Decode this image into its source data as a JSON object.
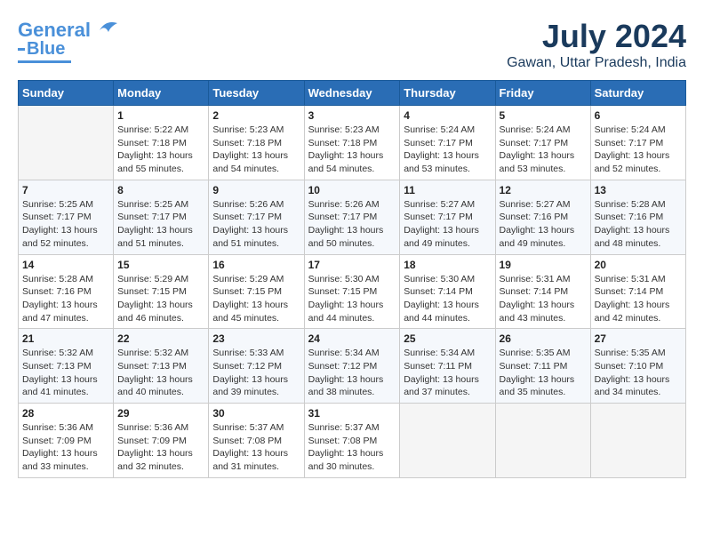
{
  "header": {
    "logo_line1": "General",
    "logo_line2": "Blue",
    "month_year": "July 2024",
    "location": "Gawan, Uttar Pradesh, India"
  },
  "calendar": {
    "days_of_week": [
      "Sunday",
      "Monday",
      "Tuesday",
      "Wednesday",
      "Thursday",
      "Friday",
      "Saturday"
    ],
    "weeks": [
      [
        {
          "day": "",
          "info": ""
        },
        {
          "day": "1",
          "info": "Sunrise: 5:22 AM\nSunset: 7:18 PM\nDaylight: 13 hours\nand 55 minutes."
        },
        {
          "day": "2",
          "info": "Sunrise: 5:23 AM\nSunset: 7:18 PM\nDaylight: 13 hours\nand 54 minutes."
        },
        {
          "day": "3",
          "info": "Sunrise: 5:23 AM\nSunset: 7:18 PM\nDaylight: 13 hours\nand 54 minutes."
        },
        {
          "day": "4",
          "info": "Sunrise: 5:24 AM\nSunset: 7:17 PM\nDaylight: 13 hours\nand 53 minutes."
        },
        {
          "day": "5",
          "info": "Sunrise: 5:24 AM\nSunset: 7:17 PM\nDaylight: 13 hours\nand 53 minutes."
        },
        {
          "day": "6",
          "info": "Sunrise: 5:24 AM\nSunset: 7:17 PM\nDaylight: 13 hours\nand 52 minutes."
        }
      ],
      [
        {
          "day": "7",
          "info": "Sunrise: 5:25 AM\nSunset: 7:17 PM\nDaylight: 13 hours\nand 52 minutes."
        },
        {
          "day": "8",
          "info": "Sunrise: 5:25 AM\nSunset: 7:17 PM\nDaylight: 13 hours\nand 51 minutes."
        },
        {
          "day": "9",
          "info": "Sunrise: 5:26 AM\nSunset: 7:17 PM\nDaylight: 13 hours\nand 51 minutes."
        },
        {
          "day": "10",
          "info": "Sunrise: 5:26 AM\nSunset: 7:17 PM\nDaylight: 13 hours\nand 50 minutes."
        },
        {
          "day": "11",
          "info": "Sunrise: 5:27 AM\nSunset: 7:17 PM\nDaylight: 13 hours\nand 49 minutes."
        },
        {
          "day": "12",
          "info": "Sunrise: 5:27 AM\nSunset: 7:16 PM\nDaylight: 13 hours\nand 49 minutes."
        },
        {
          "day": "13",
          "info": "Sunrise: 5:28 AM\nSunset: 7:16 PM\nDaylight: 13 hours\nand 48 minutes."
        }
      ],
      [
        {
          "day": "14",
          "info": "Sunrise: 5:28 AM\nSunset: 7:16 PM\nDaylight: 13 hours\nand 47 minutes."
        },
        {
          "day": "15",
          "info": "Sunrise: 5:29 AM\nSunset: 7:15 PM\nDaylight: 13 hours\nand 46 minutes."
        },
        {
          "day": "16",
          "info": "Sunrise: 5:29 AM\nSunset: 7:15 PM\nDaylight: 13 hours\nand 45 minutes."
        },
        {
          "day": "17",
          "info": "Sunrise: 5:30 AM\nSunset: 7:15 PM\nDaylight: 13 hours\nand 44 minutes."
        },
        {
          "day": "18",
          "info": "Sunrise: 5:30 AM\nSunset: 7:14 PM\nDaylight: 13 hours\nand 44 minutes."
        },
        {
          "day": "19",
          "info": "Sunrise: 5:31 AM\nSunset: 7:14 PM\nDaylight: 13 hours\nand 43 minutes."
        },
        {
          "day": "20",
          "info": "Sunrise: 5:31 AM\nSunset: 7:14 PM\nDaylight: 13 hours\nand 42 minutes."
        }
      ],
      [
        {
          "day": "21",
          "info": "Sunrise: 5:32 AM\nSunset: 7:13 PM\nDaylight: 13 hours\nand 41 minutes."
        },
        {
          "day": "22",
          "info": "Sunrise: 5:32 AM\nSunset: 7:13 PM\nDaylight: 13 hours\nand 40 minutes."
        },
        {
          "day": "23",
          "info": "Sunrise: 5:33 AM\nSunset: 7:12 PM\nDaylight: 13 hours\nand 39 minutes."
        },
        {
          "day": "24",
          "info": "Sunrise: 5:34 AM\nSunset: 7:12 PM\nDaylight: 13 hours\nand 38 minutes."
        },
        {
          "day": "25",
          "info": "Sunrise: 5:34 AM\nSunset: 7:11 PM\nDaylight: 13 hours\nand 37 minutes."
        },
        {
          "day": "26",
          "info": "Sunrise: 5:35 AM\nSunset: 7:11 PM\nDaylight: 13 hours\nand 35 minutes."
        },
        {
          "day": "27",
          "info": "Sunrise: 5:35 AM\nSunset: 7:10 PM\nDaylight: 13 hours\nand 34 minutes."
        }
      ],
      [
        {
          "day": "28",
          "info": "Sunrise: 5:36 AM\nSunset: 7:09 PM\nDaylight: 13 hours\nand 33 minutes."
        },
        {
          "day": "29",
          "info": "Sunrise: 5:36 AM\nSunset: 7:09 PM\nDaylight: 13 hours\nand 32 minutes."
        },
        {
          "day": "30",
          "info": "Sunrise: 5:37 AM\nSunset: 7:08 PM\nDaylight: 13 hours\nand 31 minutes."
        },
        {
          "day": "31",
          "info": "Sunrise: 5:37 AM\nSunset: 7:08 PM\nDaylight: 13 hours\nand 30 minutes."
        },
        {
          "day": "",
          "info": ""
        },
        {
          "day": "",
          "info": ""
        },
        {
          "day": "",
          "info": ""
        }
      ]
    ]
  }
}
